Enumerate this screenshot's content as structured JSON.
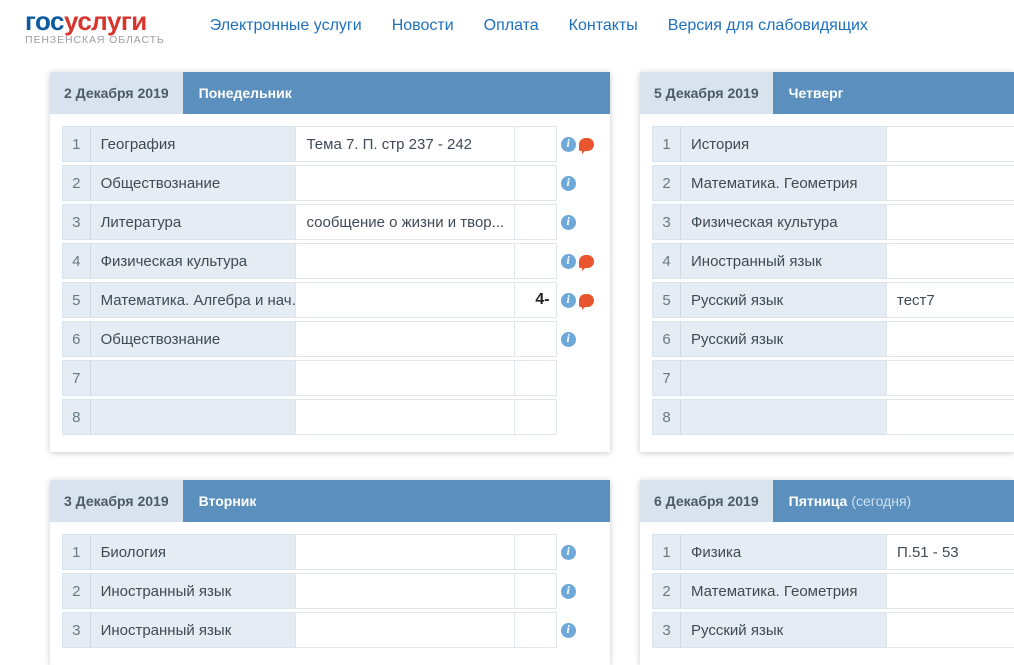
{
  "header": {
    "logo_part1": "гос",
    "logo_part2": "услуги",
    "logo_sub": "ПЕНЗЕНСКАЯ ОБЛАСТЬ",
    "nav": [
      "Электронные услуги",
      "Новости",
      "Оплата",
      "Контакты",
      "Версия для слабовидящих"
    ]
  },
  "cards": {
    "mon": {
      "date": "2 Декабря 2019",
      "day": "Понедельник",
      "rows": [
        {
          "n": "1",
          "subj": "География",
          "hw": "Тема 7. П. стр 237 - 242",
          "grade": "",
          "info": true,
          "comment": true
        },
        {
          "n": "2",
          "subj": "Обществознание",
          "hw": "",
          "grade": "",
          "info": true,
          "comment": false
        },
        {
          "n": "3",
          "subj": "Литература",
          "hw": "сообщение о жизни и твор...",
          "grade": "",
          "info": true,
          "comment": false
        },
        {
          "n": "4",
          "subj": "Физическая культура",
          "hw": "",
          "grade": "",
          "info": true,
          "comment": true
        },
        {
          "n": "5",
          "subj": "Математика. Алгебра и нач...",
          "hw": "",
          "grade": "4-",
          "info": true,
          "comment": true
        },
        {
          "n": "6",
          "subj": "Обществознание",
          "hw": "",
          "grade": "",
          "info": true,
          "comment": false
        },
        {
          "n": "7",
          "subj": "",
          "hw": "",
          "grade": "",
          "info": false,
          "comment": false
        },
        {
          "n": "8",
          "subj": "",
          "hw": "",
          "grade": "",
          "info": false,
          "comment": false
        }
      ]
    },
    "tue": {
      "date": "3 Декабря 2019",
      "day": "Вторник",
      "rows": [
        {
          "n": "1",
          "subj": "Биология",
          "hw": "",
          "grade": "",
          "info": true,
          "comment": false
        },
        {
          "n": "2",
          "subj": "Иностранный язык",
          "hw": "",
          "grade": "",
          "info": true,
          "comment": false
        },
        {
          "n": "3",
          "subj": "Иностранный язык",
          "hw": "",
          "grade": "",
          "info": true,
          "comment": false
        }
      ]
    },
    "thu": {
      "date": "5 Декабря 2019",
      "day": "Четверг",
      "rows": [
        {
          "n": "1",
          "subj": "История",
          "hw": ""
        },
        {
          "n": "2",
          "subj": "Математика. Геометрия",
          "hw": ""
        },
        {
          "n": "3",
          "subj": "Физическая культура",
          "hw": ""
        },
        {
          "n": "4",
          "subj": "Иностранный язык",
          "hw": ""
        },
        {
          "n": "5",
          "subj": "Русский язык",
          "hw": "тест7"
        },
        {
          "n": "6",
          "subj": "Русский язык",
          "hw": ""
        },
        {
          "n": "7",
          "subj": "",
          "hw": ""
        },
        {
          "n": "8",
          "subj": "",
          "hw": ""
        }
      ]
    },
    "fri": {
      "date": "6 Декабря 2019",
      "day": "Пятница",
      "today": "(сегодня)",
      "rows": [
        {
          "n": "1",
          "subj": "Физика",
          "hw": "П.51 - 53"
        },
        {
          "n": "2",
          "subj": "Математика. Геометрия",
          "hw": ""
        },
        {
          "n": "3",
          "subj": "Русский язык",
          "hw": ""
        }
      ]
    }
  }
}
